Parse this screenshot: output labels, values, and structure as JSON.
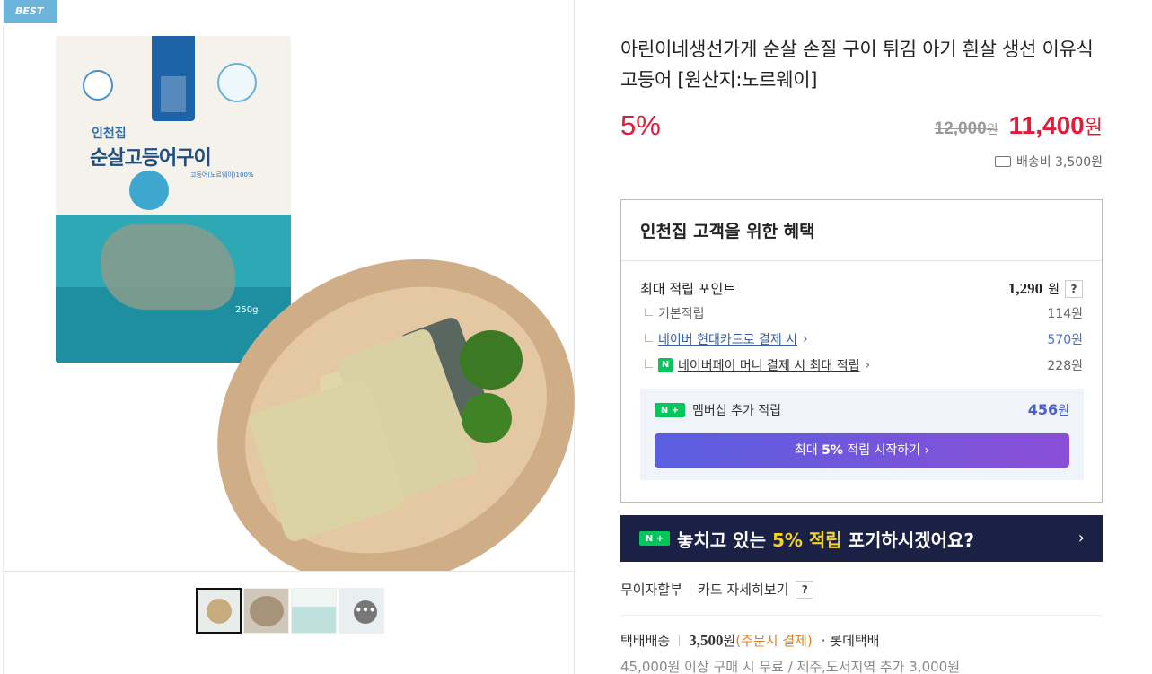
{
  "gallery": {
    "badge": "BEST",
    "package": {
      "brand": "인천집",
      "title": "순살고등어구이",
      "subtitle": "고등어(노르웨이)100%",
      "weight": "250g"
    },
    "more_label": "•••"
  },
  "product": {
    "title": "아린이네생선가게 순살 손질 구이 튀김 아기 흰살 생선 이유식 고등어 [원산지:노르웨이]",
    "discount": "5%",
    "original_price": "12,000",
    "original_won": "원",
    "sale_price": "11,400",
    "sale_won": "원",
    "shipping_fee": "배송비 3,500원"
  },
  "benefit": {
    "heading": "인천집 고객을 위한 혜택",
    "max_points_label": "최대 적립 포인트",
    "max_points_value": "1,290",
    "won": "원",
    "help": "?",
    "rows": [
      {
        "label": "기본적립",
        "value": "114원"
      },
      {
        "label": "네이버 현대카드로 결제 시",
        "value": "570원"
      },
      {
        "label": "네이버페이 머니 결제 시 최대 적립",
        "value": "228원"
      }
    ],
    "npay_icon": "N",
    "membership": {
      "logo": "N +",
      "label": "멤버십 추가 적립",
      "value": "456",
      "won": "원",
      "button_pre": "최대 ",
      "button_bold": "5%",
      "button_post": " 적립 시작하기 ›"
    }
  },
  "banner": {
    "logo": "N +",
    "text_pre": "놓치고 있는 ",
    "text_highlight": "5% 적립",
    "text_post": " 포기하시겠어요?",
    "chevron": "›"
  },
  "card": {
    "installment": "무이자할부",
    "card_detail": "카드 자세히보기",
    "help": "?"
  },
  "shipping": {
    "method": "택배배송",
    "fee": "3,500",
    "won": "원",
    "pay_note": "(주문시 결제)",
    "carrier": "· 롯데택배",
    "free_note": "45,000원 이상 구매 시 무료 / 제주,도서지역 추가 3,000원"
  }
}
